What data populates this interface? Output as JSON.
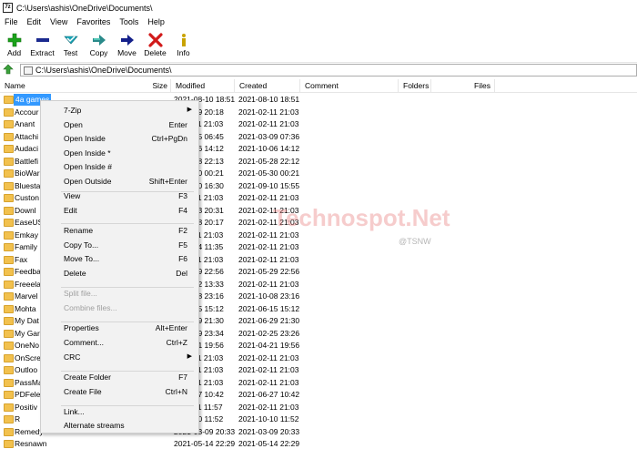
{
  "window": {
    "title": "C:\\Users\\ashis\\OneDrive\\Documents\\",
    "icon_text": "7z"
  },
  "menu": [
    "File",
    "Edit",
    "View",
    "Favorites",
    "Tools",
    "Help"
  ],
  "toolbar": [
    {
      "label": "Add",
      "icon": "add-icon",
      "color": "#1aa31a"
    },
    {
      "label": "Extract",
      "icon": "extract-icon",
      "color": "#1b2a8f"
    },
    {
      "label": "Test",
      "icon": "test-icon",
      "color": "#1aa6b8"
    },
    {
      "label": "Copy",
      "icon": "copy-icon",
      "color": "#2a8a8a"
    },
    {
      "label": "Move",
      "icon": "move-icon",
      "color": "#14208a"
    },
    {
      "label": "Delete",
      "icon": "delete-icon",
      "color": "#d11a1a"
    },
    {
      "label": "Info",
      "icon": "info-icon",
      "color": "#c9a300"
    }
  ],
  "address": "C:\\Users\\ashis\\OneDrive\\Documents\\",
  "columns": [
    "Name",
    "Size",
    "Modified",
    "Created",
    "Comment",
    "Folders",
    "Files"
  ],
  "rows": [
    {
      "name": "4a games",
      "mod": "2021-08-10 18:51",
      "cre": "2021-08-10 18:51",
      "selected": true
    },
    {
      "name": "Accour",
      "mod": "2021-09 20:18",
      "cre": "2021-02-11 21:03"
    },
    {
      "name": "Anant",
      "mod": "2021-11 21:03",
      "cre": "2021-02-11 21:03"
    },
    {
      "name": "Attachi",
      "mod": "2021-05 06:45",
      "cre": "2021-03-09 07:36"
    },
    {
      "name": "Audaci",
      "mod": "2021-06 14:12",
      "cre": "2021-10-06 14:12"
    },
    {
      "name": "Battlefi",
      "mod": "2021-28 22:13",
      "cre": "2021-05-28 22:12"
    },
    {
      "name": "BioWar",
      "mod": "2021-30 00:21",
      "cre": "2021-05-30 00:21"
    },
    {
      "name": "Bluesta",
      "mod": "2021-20 16:30",
      "cre": "2021-09-10 15:55"
    },
    {
      "name": "Custon",
      "mod": "2021-11 21:03",
      "cre": "2021-02-11 21:03"
    },
    {
      "name": "Downl",
      "mod": "2021-03 20:31",
      "cre": "2021-02-11 21:03"
    },
    {
      "name": "EaseUS",
      "mod": "2021-08 20:17",
      "cre": "2021-02-11 21:03"
    },
    {
      "name": "Emkay",
      "mod": "2021-11 21:03",
      "cre": "2021-02-11 21:03"
    },
    {
      "name": "Family",
      "mod": "2021-04 11:35",
      "cre": "2021-02-11 21:03"
    },
    {
      "name": "Fax",
      "mod": "2021-11 21:03",
      "cre": "2021-02-11 21:03"
    },
    {
      "name": "Feedba",
      "mod": "2021-29 22:56",
      "cre": "2021-05-29 22:56"
    },
    {
      "name": "Freeela",
      "mod": "2021-22 13:33",
      "cre": "2021-02-11 21:03"
    },
    {
      "name": "Marvel",
      "mod": "2021-08 23:16",
      "cre": "2021-10-08 23:16"
    },
    {
      "name": "Mohta",
      "mod": "2021-15 15:12",
      "cre": "2021-06-15 15:12"
    },
    {
      "name": "My Dat",
      "mod": "2021-29 21:30",
      "cre": "2021-06-29 21:30"
    },
    {
      "name": "My Gar",
      "mod": "2021-29 23:34",
      "cre": "2021-02-25 23:26"
    },
    {
      "name": "OneNo",
      "mod": "2021-21 19:56",
      "cre": "2021-04-21 19:56"
    },
    {
      "name": "OnScre",
      "mod": "2021-11 21:03",
      "cre": "2021-02-11 21:03"
    },
    {
      "name": "Outloo",
      "mod": "2021-11 21:03",
      "cre": "2021-02-11 21:03"
    },
    {
      "name": "PassMa",
      "mod": "2021-11 21:03",
      "cre": "2021-02-11 21:03"
    },
    {
      "name": "PDFele",
      "mod": "2021-27 10:42",
      "cre": "2021-06-27 10:42"
    },
    {
      "name": "Positiv",
      "mod": "2021-11 11:57",
      "cre": "2021-02-11 21:03"
    },
    {
      "name": "R",
      "mod": "2021-10 11:52",
      "cre": "2021-10-10 11:52"
    },
    {
      "name": "Remedy",
      "mod": "2021-03-09 20:33",
      "cre": "2021-03-09 20:33"
    },
    {
      "name": "Resnawn",
      "mod": "2021-05-14 22:29",
      "cre": "2021-05-14 22:29"
    }
  ],
  "watermark": {
    "text": "Technospot.Net",
    "sub": "@TSNW"
  },
  "context_menu": [
    {
      "label": "7-Zip",
      "shortcut": "",
      "submenu": true
    },
    {
      "label": "Open",
      "shortcut": "Enter"
    },
    {
      "label": "Open Inside",
      "shortcut": "Ctrl+PgDn"
    },
    {
      "label": "Open Inside *",
      "shortcut": ""
    },
    {
      "label": "Open Inside #",
      "shortcut": ""
    },
    {
      "label": "Open Outside",
      "shortcut": "Shift+Enter"
    },
    {
      "label": "View",
      "shortcut": "F3"
    },
    {
      "label": "Edit",
      "shortcut": "F4"
    },
    {
      "label": "Rename",
      "shortcut": "F2"
    },
    {
      "label": "Copy To...",
      "shortcut": "F5"
    },
    {
      "label": "Move To...",
      "shortcut": "F6"
    },
    {
      "label": "Delete",
      "shortcut": "Del"
    },
    {
      "label": "Split file...",
      "shortcut": "",
      "disabled": true
    },
    {
      "label": "Combine files...",
      "shortcut": "",
      "disabled": true
    },
    {
      "label": "Properties",
      "shortcut": "Alt+Enter"
    },
    {
      "label": "Comment...",
      "shortcut": "Ctrl+Z"
    },
    {
      "label": "CRC",
      "shortcut": "",
      "submenu": true
    },
    {
      "label": "Create Folder",
      "shortcut": "F7"
    },
    {
      "label": "Create File",
      "shortcut": "Ctrl+N"
    },
    {
      "label": "Link...",
      "shortcut": ""
    },
    {
      "label": "Alternate streams",
      "shortcut": ""
    }
  ]
}
